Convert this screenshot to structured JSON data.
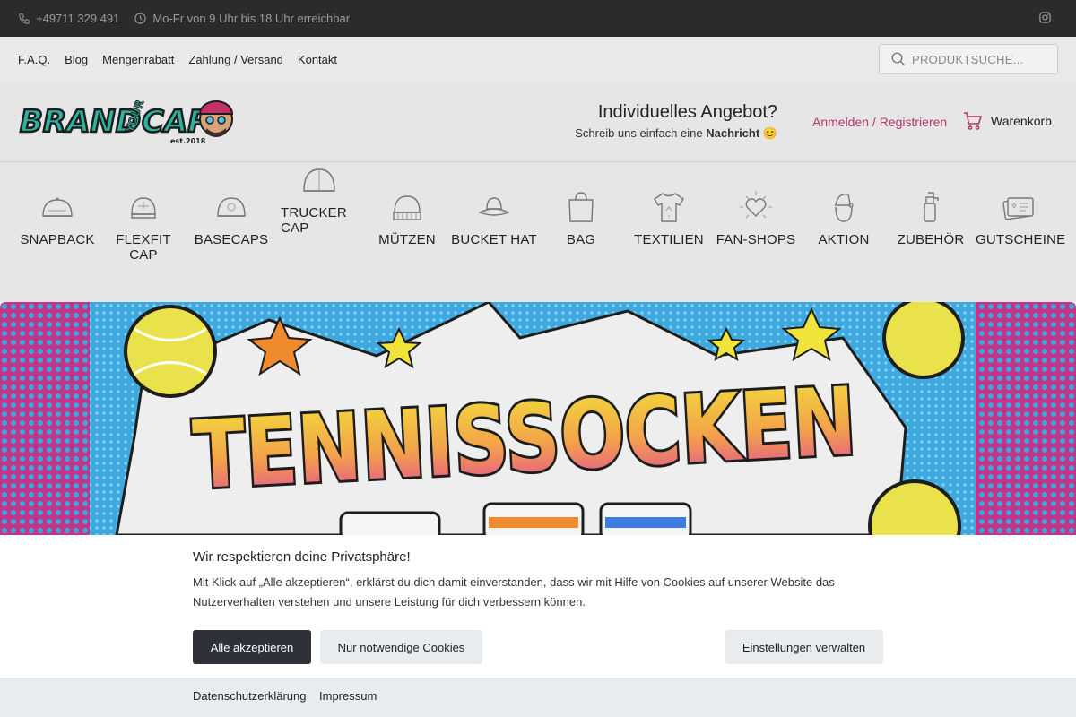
{
  "topbar": {
    "phone": "+49711 329 491",
    "hours": "Mo-Fr von 9 Uhr bis 18 Uhr erreichbar"
  },
  "nav": {
    "links": [
      "F.A.Q.",
      "Blog",
      "Mengenrabatt",
      "Zahlung / Versand",
      "Kontakt"
    ],
    "search_placeholder": "PRODUKTSUCHE..."
  },
  "header": {
    "logo_text": "BRAND YOUR CAP est.2018",
    "offer_title": "Individuelles Angebot?",
    "offer_sub_prefix": "Schreib uns einfach eine ",
    "offer_sub_bold": "Nachricht",
    "offer_emoji": "😊",
    "login": "Anmelden / Registrieren",
    "cart": "Warenkorb"
  },
  "categories": [
    {
      "label": "SNAPBACK",
      "icon": "snapback-icon"
    },
    {
      "label": "FLEXFIT CAP",
      "icon": "flexfit-cap-icon"
    },
    {
      "label": "BASECAPS",
      "icon": "basecap-icon"
    },
    {
      "label": "TRUCKER CAP",
      "icon": "trucker-cap-icon"
    },
    {
      "label": "MÜTZEN",
      "icon": "beanie-icon"
    },
    {
      "label": "BUCKET HAT",
      "icon": "bucket-hat-icon"
    },
    {
      "label": "BAG",
      "icon": "bag-icon"
    },
    {
      "label": "TEXTILIEN",
      "icon": "tshirt-icon"
    },
    {
      "label": "FAN-SHOPS",
      "icon": "heart-icon"
    },
    {
      "label": "AKTION",
      "icon": "santa-icon"
    },
    {
      "label": "ZUBEHÖR",
      "icon": "spray-bottle-icon"
    },
    {
      "label": "GUTSCHEINE",
      "icon": "voucher-icon"
    }
  ],
  "banner": {
    "headline": "TENNISSOCKEN"
  },
  "cookie": {
    "title": "Wir respektieren deine Privatsphäre!",
    "text": "Mit Klick auf „Alle akzeptieren“, erklärst du dich damit einverstanden, dass wir mit Hilfe von Cookies auf unserer Website das Nutzerverhalten verstehen und unsere Leistung für dich verbessern können.",
    "accept_all": "Alle akzeptieren",
    "only_necessary": "Nur notwendige Cookies",
    "manage": "Einstellungen verwalten",
    "privacy": "Datenschutzerklärung",
    "imprint": "Impressum"
  },
  "colors": {
    "accent_pink": "#b3376a",
    "dark_button": "#2e3138",
    "topbar": "#2b2b2b"
  }
}
